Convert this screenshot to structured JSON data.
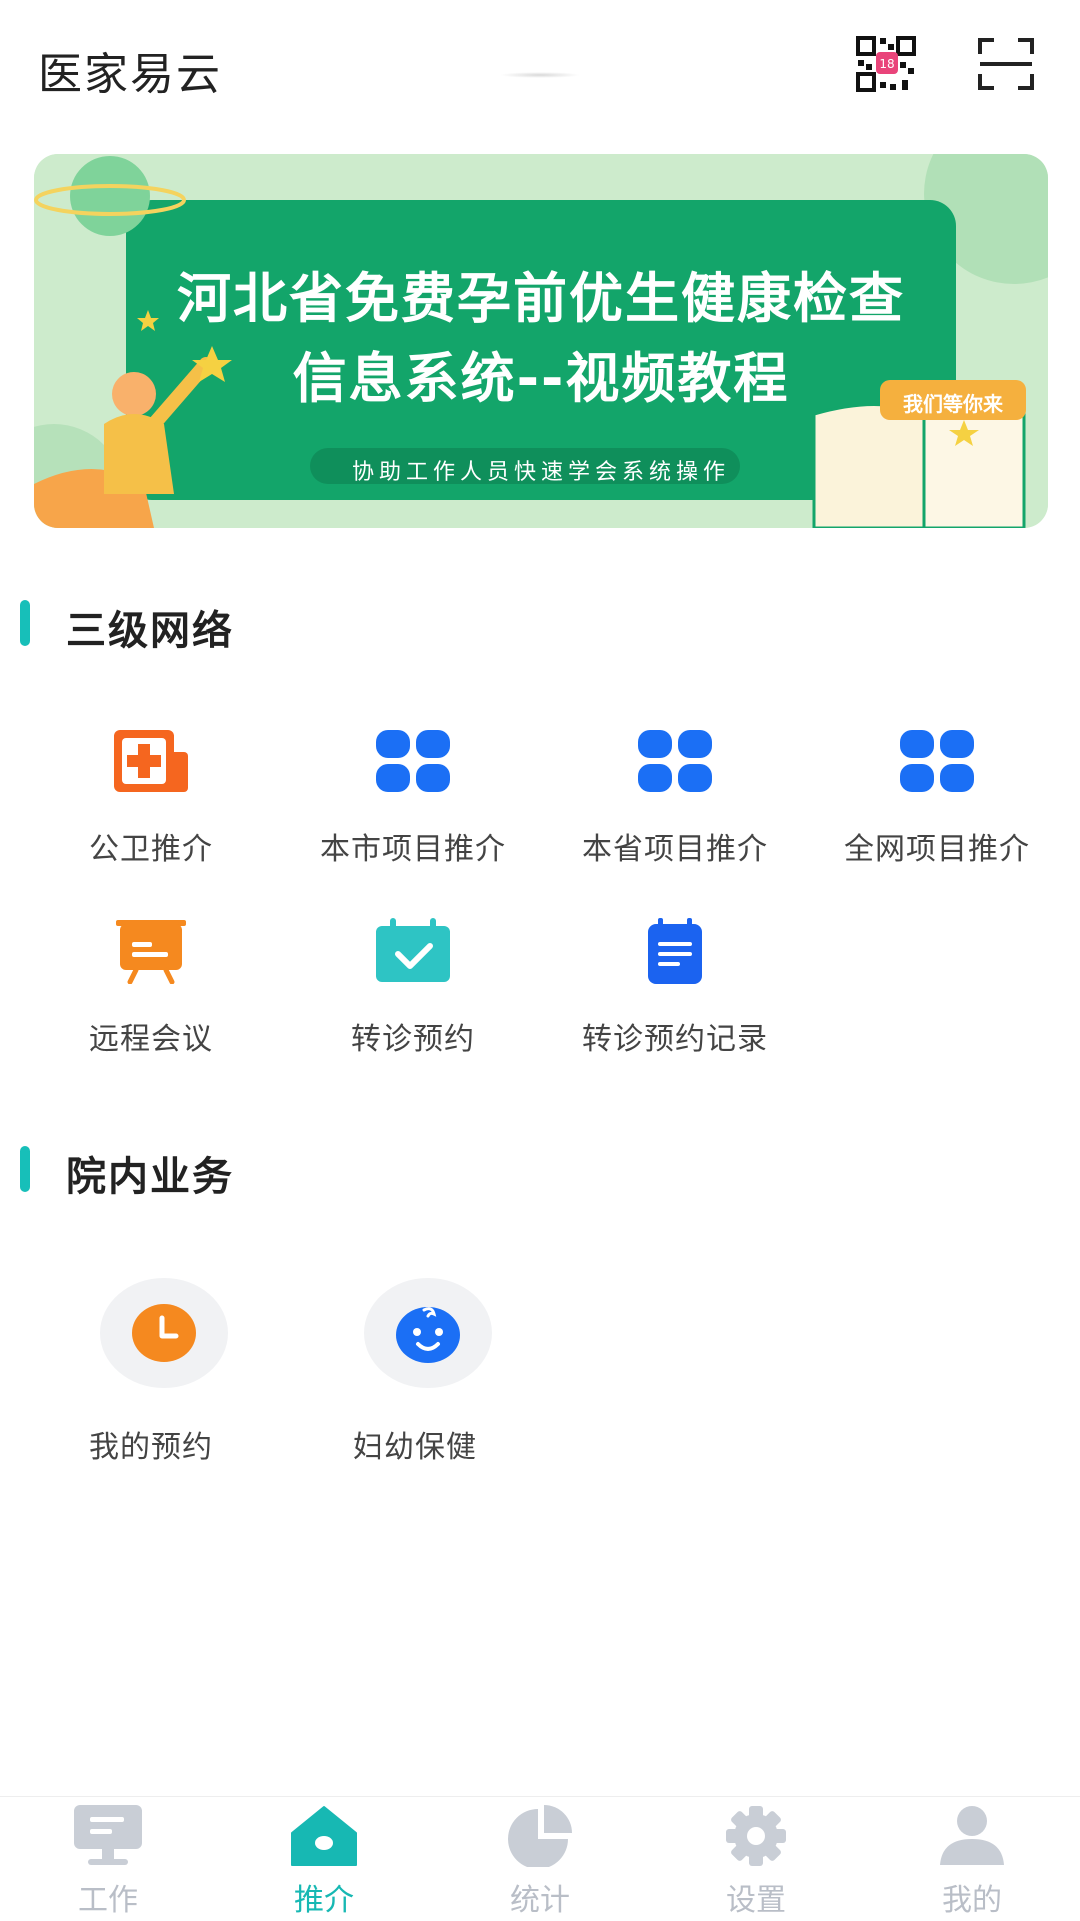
{
  "header": {
    "title": "医家易云",
    "qr_icon_badge": "18"
  },
  "banner": {
    "line1": "河北省免费孕前优生健康检查",
    "line2": "信息系统--视频教程",
    "subtitle": "协助工作人员快速学会系统操作",
    "tag": "我们等你来"
  },
  "sections": {
    "network": {
      "title": "三级网络",
      "items": [
        {
          "label": "公卫推介",
          "icon": "medical-kit-icon"
        },
        {
          "label": "本市项目推介",
          "icon": "grid-icon"
        },
        {
          "label": "本省项目推介",
          "icon": "grid-icon"
        },
        {
          "label": "全网项目推介",
          "icon": "grid-icon"
        },
        {
          "label": "远程会议",
          "icon": "presentation-board-icon"
        },
        {
          "label": "转诊预约",
          "icon": "calendar-check-icon"
        },
        {
          "label": "转诊预约记录",
          "icon": "clipboard-list-icon"
        }
      ]
    },
    "hospital": {
      "title": "院内业务",
      "items": [
        {
          "label": "我的预约",
          "icon": "clock-icon"
        },
        {
          "label": "妇幼保健",
          "icon": "baby-face-icon"
        }
      ]
    }
  },
  "tabbar": {
    "items": [
      {
        "label": "工作",
        "icon": "monitor-icon",
        "active": false
      },
      {
        "label": "推介",
        "icon": "home-icon",
        "active": true
      },
      {
        "label": "统计",
        "icon": "pie-chart-icon",
        "active": false
      },
      {
        "label": "设置",
        "icon": "gear-icon",
        "active": false
      },
      {
        "label": "我的",
        "icon": "user-icon",
        "active": false
      }
    ]
  },
  "colors": {
    "accent": "#17bfb9",
    "grid_blue": "#1b6ff5",
    "orange": "#f5891f",
    "teal": "#2ec4c4",
    "tab_inactive": "#b9bec7",
    "banner_green": "#13a56a"
  }
}
